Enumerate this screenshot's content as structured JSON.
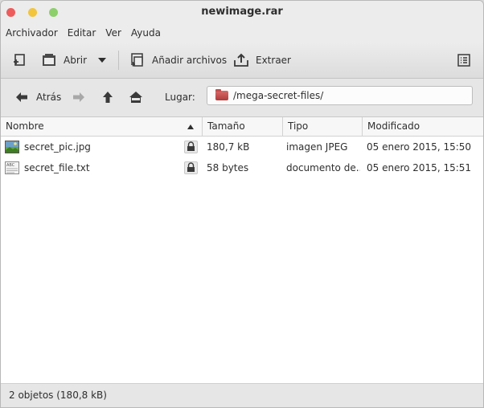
{
  "window": {
    "title": "newimage.rar"
  },
  "menubar": {
    "items": [
      "Archivador",
      "Editar",
      "Ver",
      "Ayuda"
    ]
  },
  "toolbar": {
    "new_icon": "new-archive-icon",
    "open_label": "Abrir",
    "add_label": "Añadir archivos",
    "extract_label": "Extraer",
    "properties_icon": "properties-list-icon"
  },
  "location": {
    "back_label": "Atrás",
    "place_label": "Lugar:",
    "path": "/mega-secret-files/"
  },
  "list": {
    "columns": [
      "Nombre",
      "Tamaño",
      "Tipo",
      "Modificado"
    ],
    "rows": [
      {
        "name": "secret_pic.jpg",
        "size": "180,7 kB",
        "type": "imagen JPEG",
        "modified": "05 enero 2015, 15:50",
        "icon": "image-file-icon"
      },
      {
        "name": "secret_file.txt",
        "size": "58 bytes",
        "type": "documento de...",
        "modified": "05 enero 2015, 15:51",
        "icon": "text-file-icon"
      }
    ]
  },
  "status": {
    "text": "2 objetos (180,8 kB)"
  },
  "colors": {
    "close": "#ee5b5b",
    "minimize": "#f2c53d",
    "maximize": "#8dcf6b",
    "folder": "#c44e4e"
  }
}
